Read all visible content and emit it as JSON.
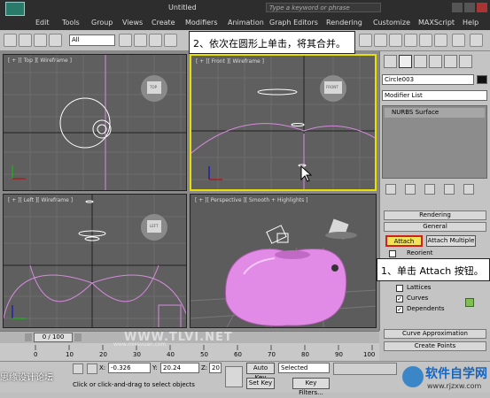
{
  "titlebar": {
    "title": "Untitled",
    "search_placeholder": "Type a keyword or phrase"
  },
  "menu": [
    "Edit",
    "Tools",
    "Group",
    "Views",
    "Create",
    "Modifiers",
    "Animation",
    "Graph Editors",
    "Rendering",
    "Customize",
    "MAXScript",
    "Help"
  ],
  "toolbar": {
    "selection_filter": "All"
  },
  "viewports": {
    "top": "[ + ][ Top ][ Wireframe ]",
    "front": "[ + ][ Front ][ Wireframe ]",
    "left": "[ + ][ Left ][ Wireframe ]",
    "perspective": "[ + ][ Perspective ][ Smooth + Highlights ]",
    "cube_top": "TOP",
    "cube_front": "FRONT",
    "cube_left": "LEFT"
  },
  "command_panel": {
    "object_name": "Circle003",
    "modifier_list": "Modifier List",
    "stack_item": "NURBS Surface",
    "rollouts": {
      "rendering": "Rendering",
      "general": "General",
      "curve_approximation": "Curve Approximation",
      "create_points": "Create Points"
    },
    "attach": "Attach",
    "attach_multiple": "Attach Multiple",
    "reorient": "Reorient",
    "lattices": "Lattices",
    "curves": "Curves",
    "dependents": "Dependents"
  },
  "callouts": {
    "step2": "2、依次在圆形上单击，将其合并。",
    "step1": "1、单击 Attach 按钮。"
  },
  "timeline": {
    "frame": "0 / 100",
    "ticks": [
      "0",
      "10",
      "20",
      "30",
      "40",
      "50",
      "60",
      "70",
      "80",
      "90",
      "100"
    ]
  },
  "status": {
    "x_label": "X:",
    "x_value": "-0.326",
    "y_label": "Y:",
    "y_value": "20.24",
    "z_label": "Z:",
    "z_value": "20",
    "prompt": "Click or click-and-drag to select objects",
    "auto_key": "Auto Key",
    "selected": "Selected",
    "set_key": "Set Key",
    "key_filters": "Key Filters..."
  },
  "watermark": {
    "left": "思缘设计论坛",
    "center": "WWW.TLVI.NET",
    "right_top": "www.missvuan.com"
  },
  "logo": {
    "text": "软件自学网",
    "url": "www.rjzxw.com"
  }
}
